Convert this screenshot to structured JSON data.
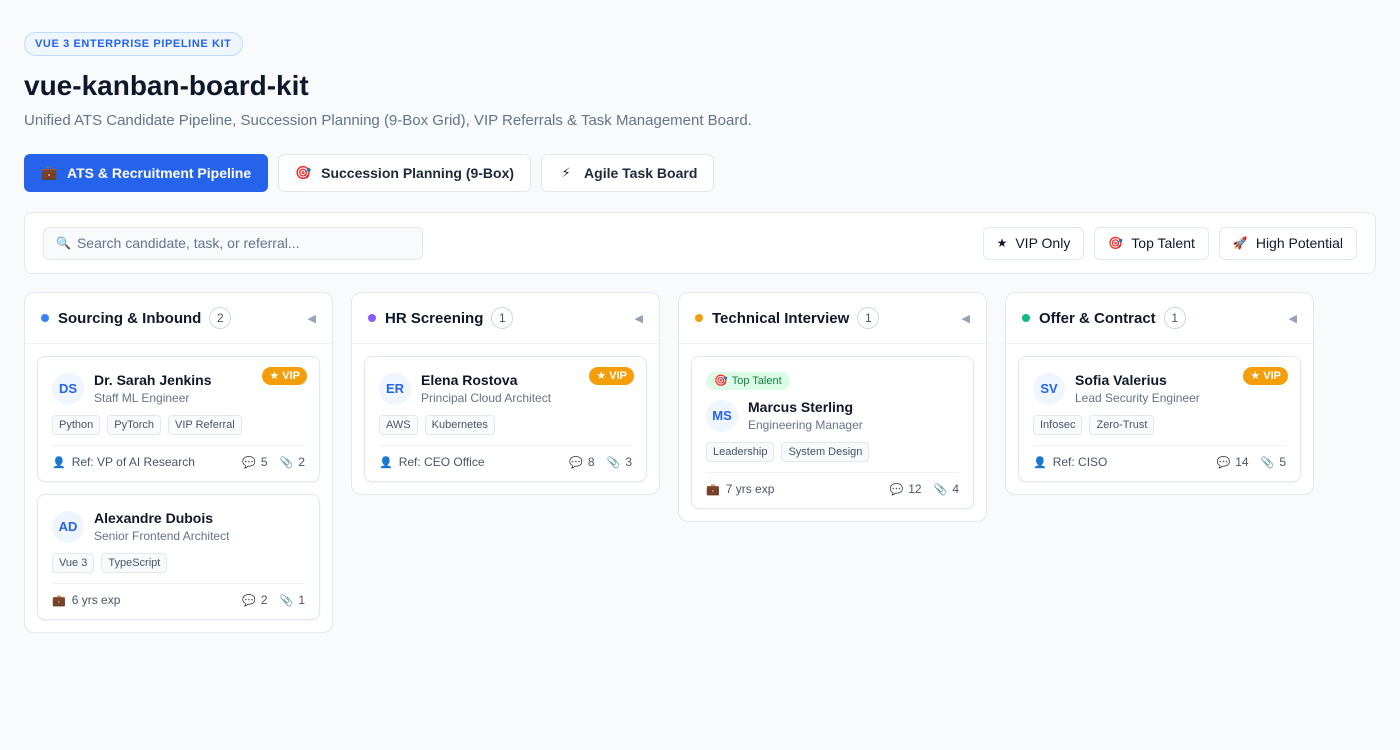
{
  "header": {
    "badge": "VUE 3 ENTERPRISE PIPELINE KIT",
    "title": "vue-kanban-board-kit",
    "subtitle": "Unified ATS Candidate Pipeline, Succession Planning (9-Box Grid), VIP Referrals & Task Management Board."
  },
  "tabs": [
    {
      "label": "ATS & Recruitment Pipeline",
      "icon": "briefcase-icon",
      "glyph": "💼",
      "active": true
    },
    {
      "label": "Succession Planning (9-Box)",
      "icon": "target-icon",
      "glyph": "🎯",
      "active": false
    },
    {
      "label": "Agile Task Board",
      "icon": "lightning-icon",
      "glyph": "⚡",
      "active": false
    }
  ],
  "toolbar": {
    "search_placeholder": "Search candidate, task, or referral...",
    "search_glyph": "🔍",
    "filters": [
      {
        "label": "VIP Only",
        "glyph": "★"
      },
      {
        "label": "Top Talent",
        "glyph": "🎯"
      },
      {
        "label": "High Potential",
        "glyph": "🚀"
      }
    ]
  },
  "icons": {
    "comment": "💬",
    "attachment": "📎",
    "person": "👤",
    "briefcase": "💼",
    "collapse": "◀",
    "target": "🎯"
  },
  "colors": {
    "accent": "#2563eb",
    "vip": "#f59e0b",
    "top_talent_bg": "#dcfce7"
  },
  "columns": [
    {
      "title": "Sourcing & Inbound",
      "count": "2",
      "dot": "#3b82f6",
      "cards": [
        {
          "initials": "DS",
          "name": "Dr. Sarah Jenkins",
          "role": "Staff ML Engineer",
          "vip": "★ VIP",
          "tags": [
            "Python",
            "PyTorch",
            "VIP Referral"
          ],
          "meta_type": "person",
          "meta": "Ref: VP of AI Research",
          "comments": "5",
          "attachments": "2"
        },
        {
          "initials": "AD",
          "name": "Alexandre Dubois",
          "role": "Senior Frontend Architect",
          "tags": [
            "Vue 3",
            "TypeScript"
          ],
          "meta_type": "briefcase",
          "meta": "6 yrs exp",
          "comments": "2",
          "attachments": "1"
        }
      ]
    },
    {
      "title": "HR Screening",
      "count": "1",
      "dot": "#8b5cf6",
      "cards": [
        {
          "initials": "ER",
          "name": "Elena Rostova",
          "role": "Principal Cloud Architect",
          "vip": "★ VIP",
          "tags": [
            "AWS",
            "Kubernetes"
          ],
          "meta_type": "person",
          "meta": "Ref: CEO Office",
          "comments": "8",
          "attachments": "3"
        }
      ]
    },
    {
      "title": "Technical Interview",
      "count": "1",
      "dot": "#f59e0b",
      "cards": [
        {
          "initials": "MS",
          "name": "Marcus Sterling",
          "role": "Engineering Manager",
          "top_talent": "Top Talent",
          "tags": [
            "Leadership",
            "System Design"
          ],
          "meta_type": "briefcase",
          "meta": "7 yrs exp",
          "comments": "12",
          "attachments": "4"
        }
      ]
    },
    {
      "title": "Offer & Contract",
      "count": "1",
      "dot": "#10b981",
      "cards": [
        {
          "initials": "SV",
          "name": "Sofia Valerius",
          "role": "Lead Security Engineer",
          "vip": "★ VIP",
          "tags": [
            "Infosec",
            "Zero-Trust"
          ],
          "meta_type": "person",
          "meta": "Ref: CISO",
          "comments": "14",
          "attachments": "5"
        }
      ]
    }
  ]
}
